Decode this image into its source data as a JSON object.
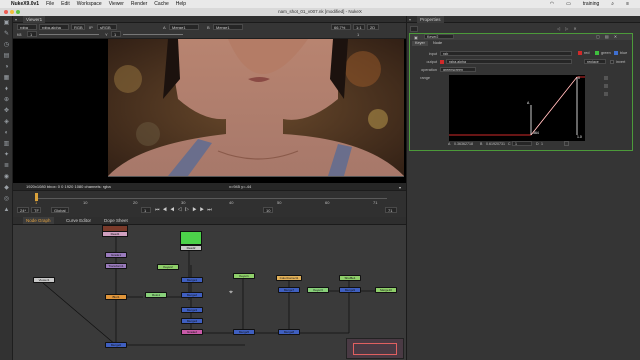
{
  "menubar": {
    "app": "NukeX9.0v1",
    "items": [
      "File",
      "Edit",
      "Workspace",
      "Viewer",
      "Render",
      "Cache",
      "Help"
    ],
    "user": "training"
  },
  "window": {
    "title": "nam_shot_01_v007.nk [modified] - NukeX"
  },
  "viewer": {
    "tab": "Viewer1",
    "channels": "rgba",
    "layer": "rgba.alpha",
    "display_channel": "RGB",
    "ip_label": "IP",
    "lut": "sRGB",
    "input_a": "A",
    "input_a_node": "Merge1",
    "input_b": "B",
    "input_b_node": "Merge1",
    "zoom": "66.7%",
    "zoom_mode": "1:1",
    "proxy": "2D",
    "gain_label": "f/8",
    "gain_value": "1",
    "gamma_label": "Y",
    "gamma_value": "1",
    "frame_range": "1",
    "status_left": "1920x1080  bbox: 0 0 1920 1080 channels: rgba",
    "status_coords": "x=945 y=-44"
  },
  "timeline": {
    "fps_value": "24*",
    "tc_value": "TF",
    "global_label": "Global",
    "current_frame": "1",
    "step_value": "10",
    "end_frame": "71",
    "ticks": [
      "1",
      "10",
      "20",
      "30",
      "40",
      "50",
      "60",
      "71"
    ]
  },
  "nodegraph": {
    "tabs": [
      "Node Graph",
      "Curve Editor",
      "Dope Sheet"
    ],
    "nodes": [
      {
        "label": "Read1",
        "color": "#d0a0c0"
      },
      {
        "label": "Read2",
        "color": "#c8c8c8"
      },
      {
        "label": "Grade1",
        "color": "#9a7bbd"
      },
      {
        "label": "Keyer2",
        "color": "#8fcf6a"
      },
      {
        "label": "Merge1",
        "color": "#3f5fc0"
      },
      {
        "label": "Blur1",
        "color": "#e0953a"
      },
      {
        "label": "Transform1",
        "color": "#b89adf"
      },
      {
        "label": "Merge2",
        "color": "#3f5fc0"
      },
      {
        "label": "Roto1",
        "color": "#88d07a"
      },
      {
        "label": "Merge3",
        "color": "#3f5fc0"
      },
      {
        "label": "Merge4",
        "color": "#3f5fc0"
      },
      {
        "label": "Grade2",
        "color": "#c85aa8"
      },
      {
        "label": "Keyer1",
        "color": "#8fcf6a"
      },
      {
        "label": "Merge5",
        "color": "#3f5fc0"
      },
      {
        "label": "Merge6",
        "color": "#3f5fc0"
      },
      {
        "label": "ColorCorrect1",
        "color": "#e3b25a"
      },
      {
        "label": "Merge7",
        "color": "#3f5fc0"
      },
      {
        "label": "Keyer3",
        "color": "#8fcf6a"
      },
      {
        "label": "Merge8",
        "color": "#3f5fc0"
      },
      {
        "label": "Merge9",
        "color": "#3f5fc0"
      },
      {
        "label": "Shuffle1",
        "color": "#8fcf6a"
      },
      {
        "label": "Merge10",
        "color": "#3f5fc0"
      },
      {
        "label": "Viewer1",
        "color": "#c8c8c8"
      }
    ]
  },
  "properties": {
    "tab": "Properties",
    "node_name": "Keyer2",
    "panel_tabs": [
      "Keyer",
      "Node"
    ],
    "input_label": "input",
    "input_value": "rgb",
    "red_label": "red",
    "green_label": "green",
    "blue_label": "blue",
    "output_label": "output",
    "output_value": "rgba.alpha",
    "replace_value": "replace",
    "invert_label": "invert",
    "operation_label": "operation",
    "operation_value": "greenscreen",
    "range_label": "range",
    "curve_labels": {
      "left_marker": "A",
      "mid_value": "364",
      "top_value": "0",
      "right_value": "1.0"
    },
    "readout": {
      "a_label": "A",
      "a_value": "0.36362718",
      "b_label": "B",
      "b_value": "0.61920731",
      "c_label": "C",
      "c_value": "1",
      "d_label": "D",
      "d_value": "1"
    }
  },
  "colors": {
    "accent": "#d9a13a",
    "panel_border": "#4c9a3a",
    "curve_red": "#d12a2a",
    "curve_white": "#ffffff"
  }
}
